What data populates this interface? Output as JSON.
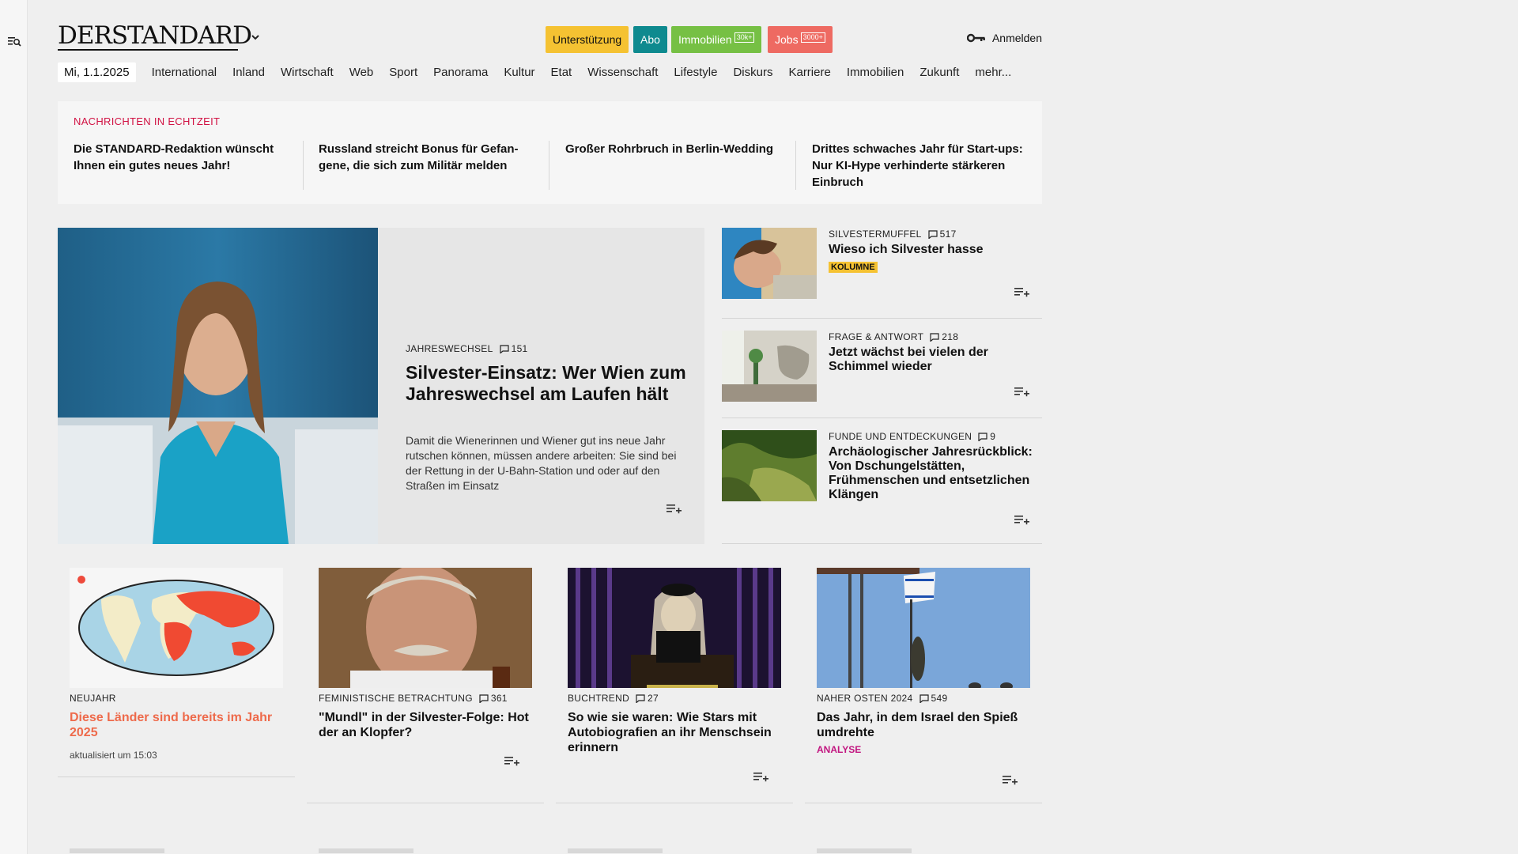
{
  "brand": {
    "logo": "DERSTANDARD"
  },
  "promos": [
    {
      "label": "Unterstützung"
    },
    {
      "label": "Abo"
    },
    {
      "label": "Immobilien",
      "badge": "30k+"
    },
    {
      "label": "Jobs",
      "badge": "3000+"
    }
  ],
  "login": {
    "label": "Anmelden"
  },
  "nav": {
    "date": "Mi, 1.1.2025",
    "items": [
      "International",
      "Inland",
      "Wirtschaft",
      "Web",
      "Sport",
      "Panorama",
      "Kultur",
      "Etat",
      "Wissenschaft",
      "Lifestyle",
      "Diskurs",
      "Karriere",
      "Immobilien",
      "Zukunft",
      "mehr..."
    ]
  },
  "ticker": {
    "label": "NACHRICHTEN IN ECHTZEIT",
    "items": [
      "Die STANDARD-Redaktion wünscht Ihnen ein gutes neues Jahr!",
      "Russland streicht Bonus für Gefan-gene, die sich zum Militär melden",
      "Großer Rohrbruch in Berlin-Wedding",
      "Drittes schwaches Jahr für Start-ups: Nur KI-Hype verhinderte stärkeren Einbruch"
    ]
  },
  "lead": {
    "kicker": "JAHRESWECHSEL",
    "comments": "151",
    "title": "Silvester-Einsatz: Wer Wien zum Jahreswechsel am Laufen hält",
    "teaser": "Damit die Wienerinnen und Wiener gut ins neue Jahr rutschen können, müssen andere arbeiten: Sie sind bei der Rettung in der U-Bahn-Station und oder auf den Straßen im Einsatz"
  },
  "side": [
    {
      "kicker": "SILVESTERMUFFEL",
      "comments": "517",
      "title": "Wieso ich Silvester hasse",
      "tag": "KOLUMNE"
    },
    {
      "kicker": "FRAGE & ANTWORT",
      "comments": "218",
      "title": "Jetzt wächst bei vielen der Schimmel wieder"
    },
    {
      "kicker": "FUNDE UND ENTDECKUNGEN",
      "comments": "9",
      "title": "Archäologischer Jahresrückblick: Von Dschungelstätten, Frühmenschen und entsetzlichen Klängen"
    }
  ],
  "cards": [
    {
      "kicker": "NEUJAHR",
      "title": "Diese Länder sind bereits im Jahr 2025",
      "sub": "aktualisiert um 15:03"
    },
    {
      "kicker": "FEMINISTISCHE BETRACHTUNG",
      "comments": "361",
      "title": "\"Mundl\" in der Silvester-Folge: Hot der an Klopfer?"
    },
    {
      "kicker": "BUCHTREND",
      "comments": "27",
      "title": "So wie sie waren: Wie Stars mit Autobiografien an ihr Menschsein erinnern"
    },
    {
      "kicker": "NAHER OSTEN 2024",
      "comments": "549",
      "title": "Das Jahr, in dem Israel den Spieß umdrehte",
      "tag": "ANALYSE"
    }
  ],
  "colors": {
    "ticker_label": "#d11243",
    "kolumne": "#f5c232",
    "analyse": "#c21680",
    "neujahr_title": "#ee6a4b"
  }
}
